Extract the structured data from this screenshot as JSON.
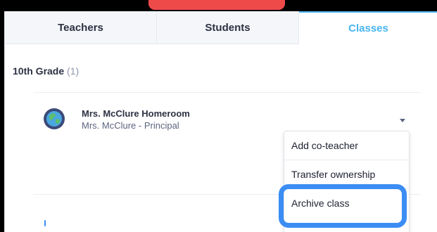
{
  "tabs": [
    {
      "label": "Teachers",
      "active": false
    },
    {
      "label": "Students",
      "active": false
    },
    {
      "label": "Classes",
      "active": true
    }
  ],
  "group": {
    "title": "10th Grade",
    "count": "(1)"
  },
  "class_item": {
    "name": "Mrs. McClure Homeroom",
    "owner": "Mrs. McClure - Principal",
    "icon": "globe-icon"
  },
  "menu": {
    "items": [
      {
        "label": "Add co-teacher"
      },
      {
        "label": "Transfer ownership"
      },
      {
        "label": "Archive class"
      }
    ],
    "highlighted": "Archive class"
  },
  "colors": {
    "accent": "#49b5f0",
    "highlight": "#3b8df3",
    "top_marker": "#ef4a4a",
    "text_primary": "#2d3142",
    "text_muted": "#8e95ad"
  }
}
